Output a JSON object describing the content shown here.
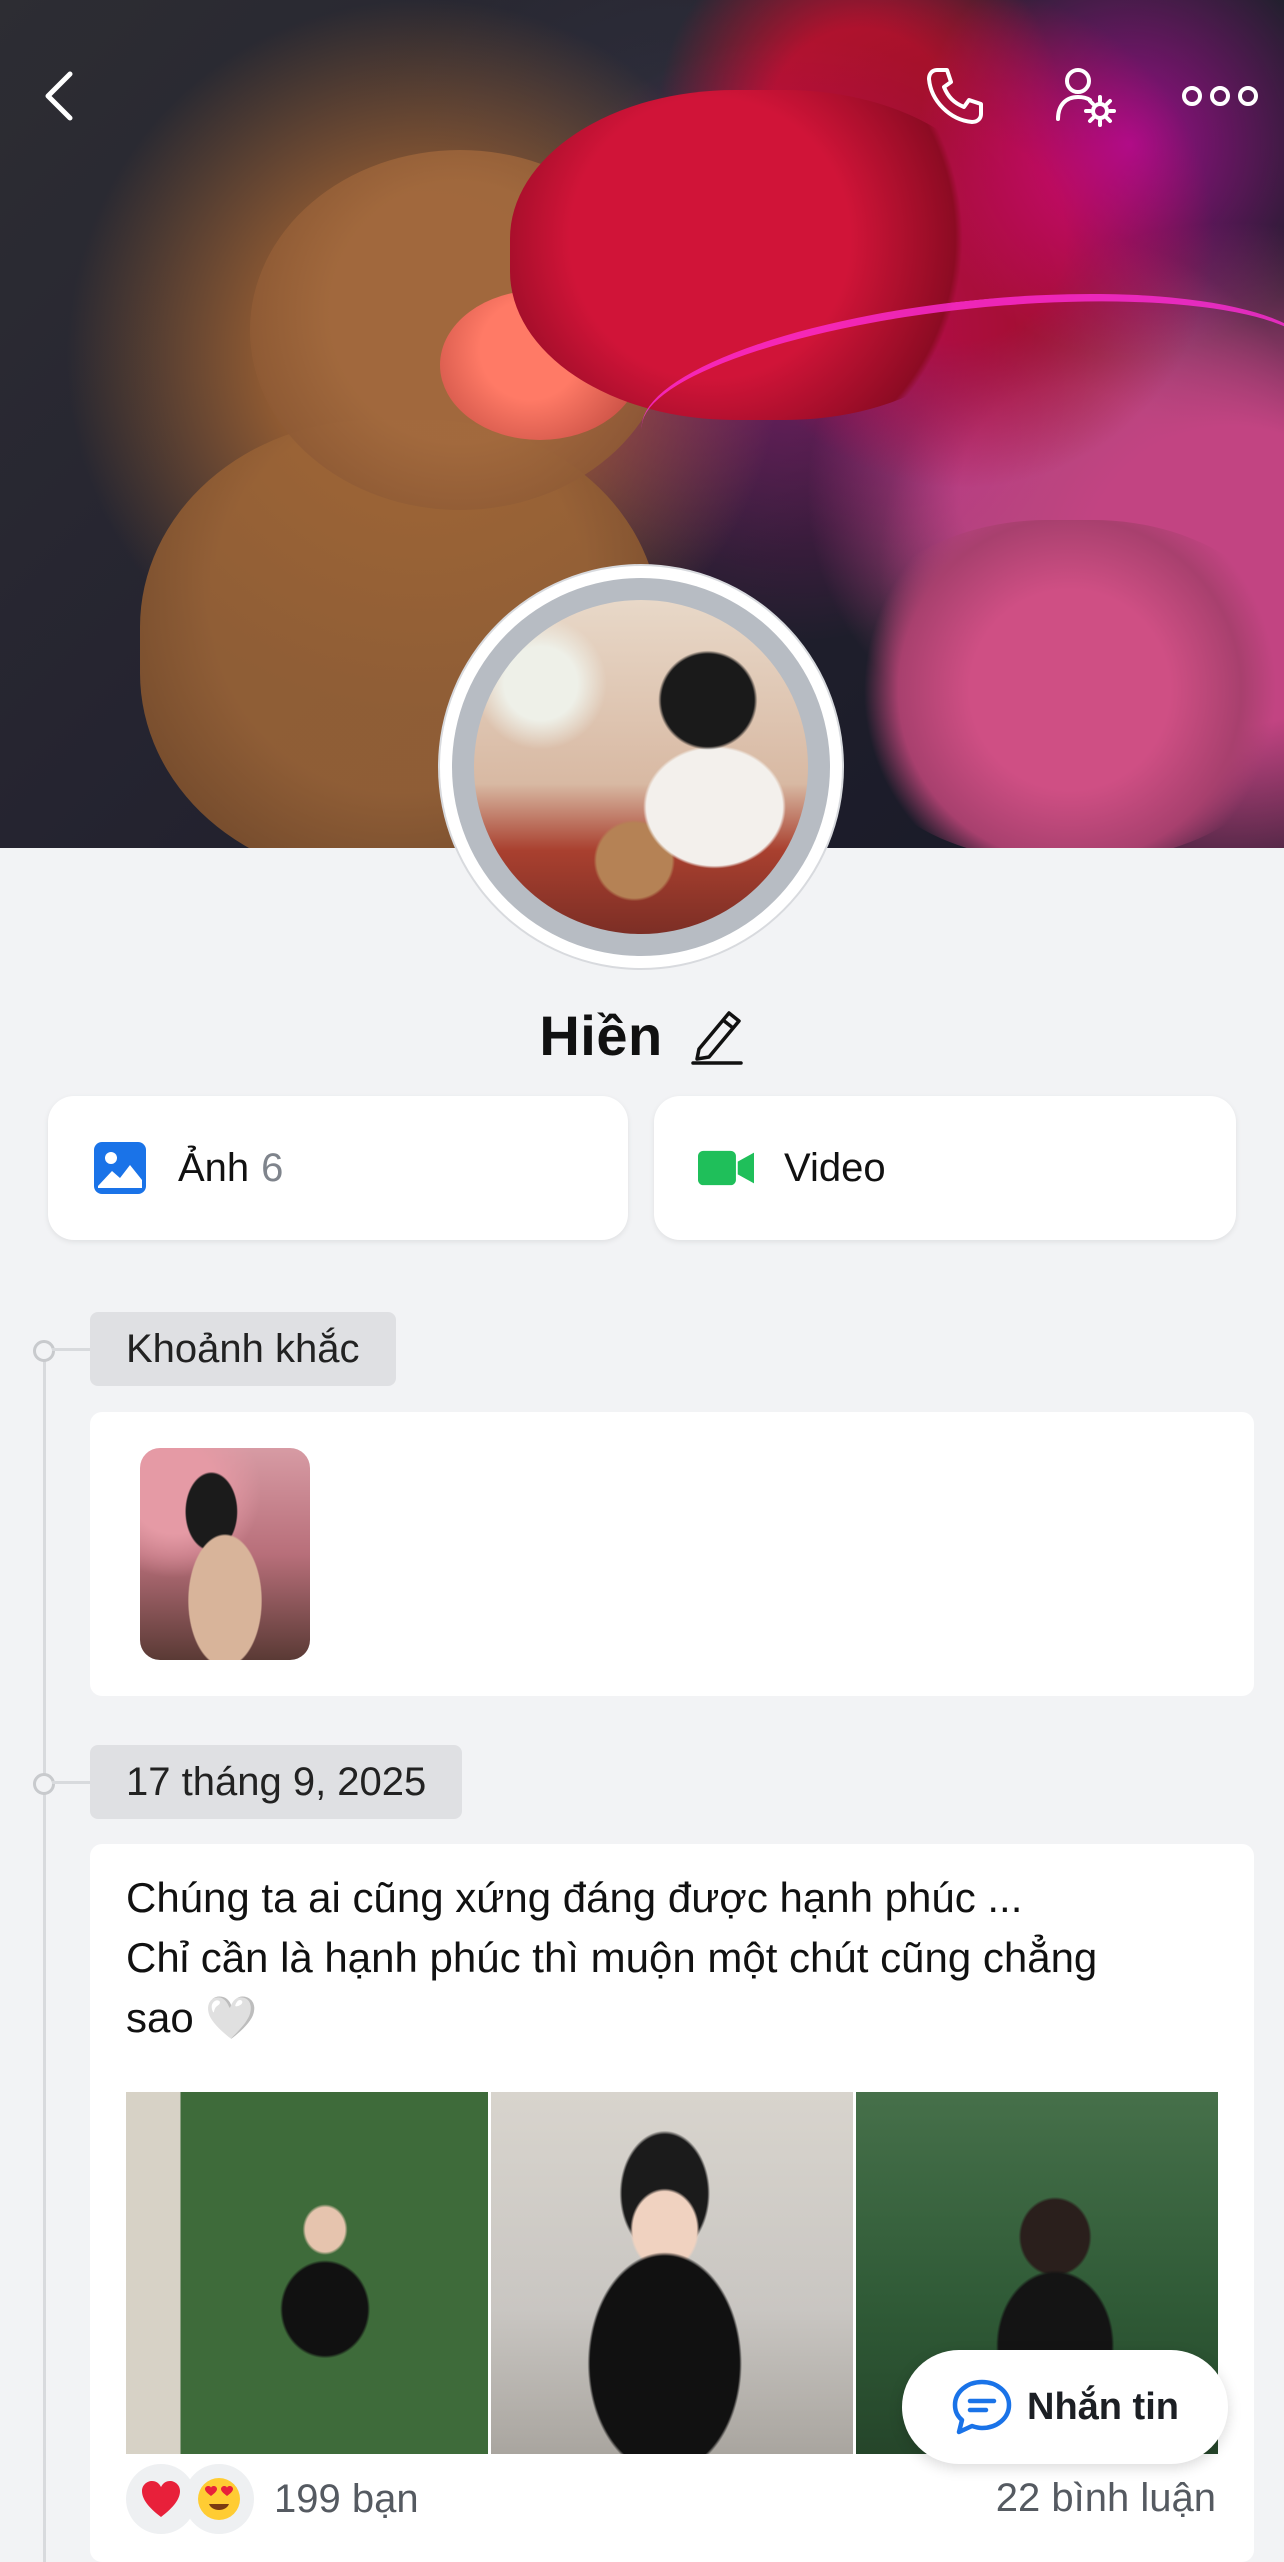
{
  "profile": {
    "name": "Hiền"
  },
  "media_buttons": {
    "photos_label": "Ảnh",
    "photos_count": "6",
    "video_label": "Video"
  },
  "timeline": {
    "moments_tag": "Khoảnh khắc",
    "post_date": "17 tháng 9, 2025",
    "post_lines": [
      "Chúng ta ai cũng xứng đáng được hạnh phúc ...",
      "Chỉ cần là hạnh phúc thì muộn một chút cũng chẳng",
      "sao 🤍"
    ],
    "reactions_count": "199 bạn",
    "comments_count": "22 bình luận"
  },
  "chat_button": {
    "label": "Nhắn tin"
  },
  "icons": {
    "back": "chevron-left-icon",
    "call": "phone-icon",
    "settings": "user-settings-icon",
    "more": "more-icon",
    "edit": "pencil-icon",
    "photos": "image-icon",
    "video": "video-camera-icon",
    "chat": "chat-bubble-icon"
  },
  "colors": {
    "accent_blue": "#1a73e8",
    "video_green": "#1fbf5a",
    "background": "#f2f3f5"
  }
}
